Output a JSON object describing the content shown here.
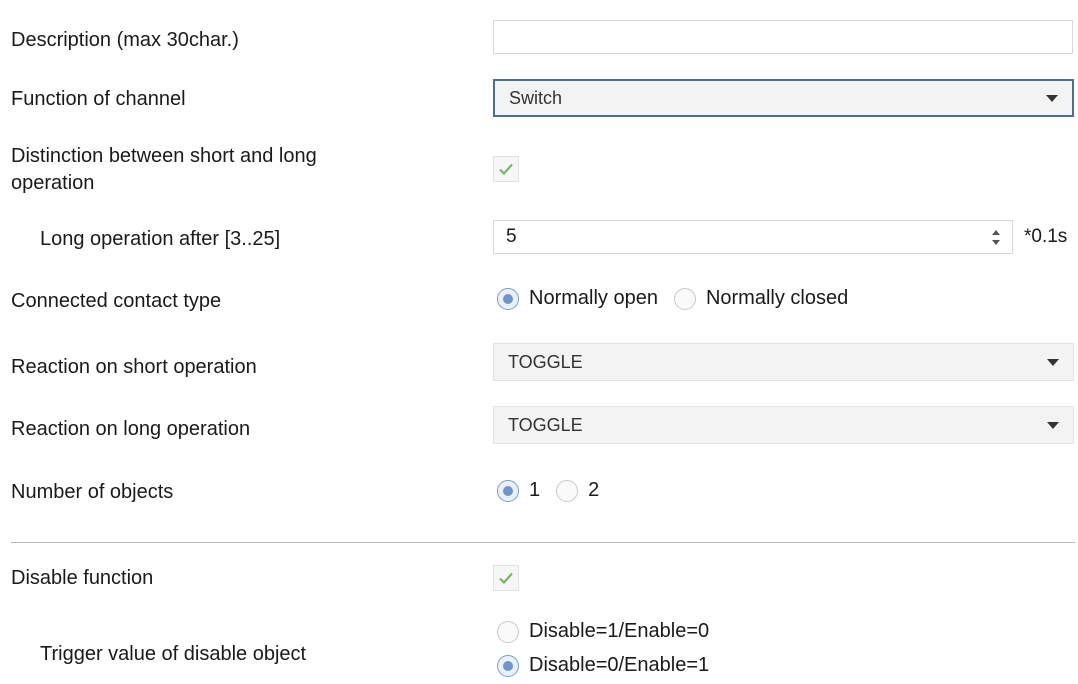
{
  "labels": {
    "description": "Description (max 30char.)",
    "function_of_channel": "Function of channel",
    "distinction_line1": "Distinction between short and long",
    "distinction_line2": "operation",
    "long_operation_after": "Long operation after [3..25]",
    "connected_contact_type": "Connected contact type",
    "reaction_short": "Reaction on short operation",
    "reaction_long": "Reaction on long operation",
    "number_of_objects": "Number of objects",
    "disable_function": "Disable function",
    "trigger_value": "Trigger value of disable object"
  },
  "fields": {
    "description_value": "",
    "function_of_channel_value": "Switch",
    "distinction_checked": true,
    "long_operation_value": "5",
    "long_operation_unit": "*0.1s",
    "contact_type_options": [
      "Normally open",
      "Normally closed"
    ],
    "contact_type_selected": "Normally open",
    "reaction_short_value": "TOGGLE",
    "reaction_long_value": "TOGGLE",
    "number_of_objects_options": [
      "1",
      "2"
    ],
    "number_of_objects_selected": "1",
    "disable_function_checked": true,
    "trigger_options": [
      "Disable=1/Enable=0",
      "Disable=0/Enable=1"
    ],
    "trigger_selected": "Disable=0/Enable=1"
  },
  "colors": {
    "check_mark": "#7cb36a",
    "radio_selected": "#6f95c7",
    "focus_border": "#4a6e9c"
  },
  "icons": {
    "checkbox_mark": "checkmark-icon",
    "dropdown_arrow": "chevron-down-icon",
    "spin_up": "caret-up-icon",
    "spin_down": "caret-down-icon"
  }
}
